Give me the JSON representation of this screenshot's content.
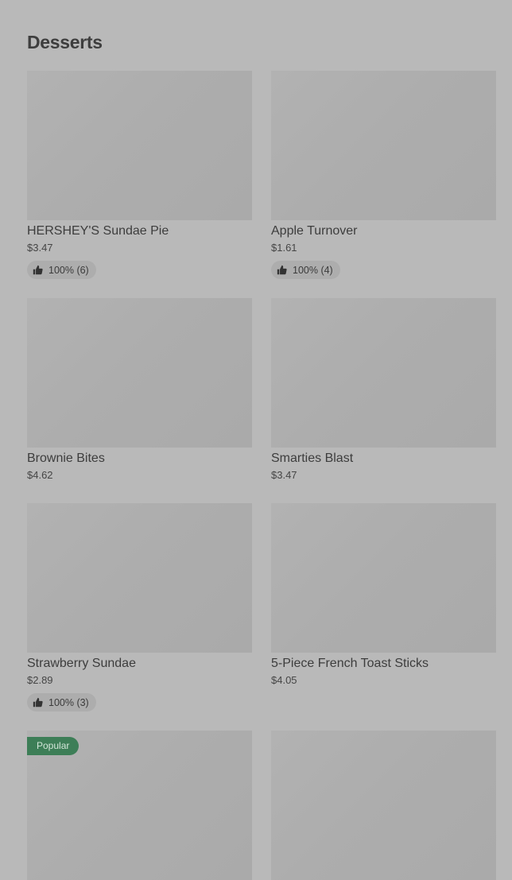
{
  "section": {
    "title": "Desserts"
  },
  "items": [
    {
      "name": "HERSHEY'S Sundae Pie",
      "price": "$3.47",
      "rating": "100% (6)"
    },
    {
      "name": "Apple Turnover",
      "price": "$1.61",
      "rating": "100% (4)"
    },
    {
      "name": "Brownie Bites",
      "price": "$4.62"
    },
    {
      "name": "Smarties Blast",
      "price": "$3.47"
    },
    {
      "name": "Strawberry Sundae",
      "price": "$2.89",
      "rating": "100% (3)"
    },
    {
      "name": "5-Piece French Toast Sticks",
      "price": "$4.05"
    },
    {
      "badge": "Popular"
    },
    {}
  ],
  "icons": {
    "rating": "thumbs-up-icon"
  }
}
